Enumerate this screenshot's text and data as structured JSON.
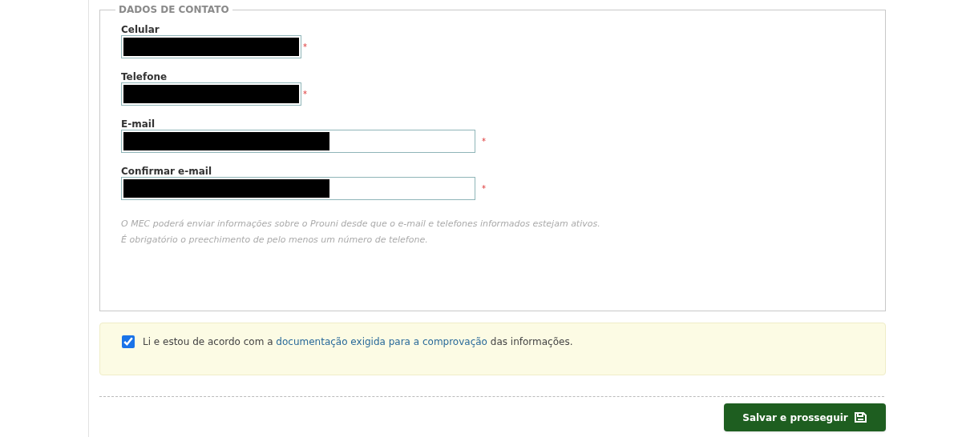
{
  "section": {
    "legend": "DADOS DE CONTATO",
    "fields": [
      {
        "label": "Celular",
        "kind": "phone",
        "required_mark": "*"
      },
      {
        "label": "Telefone",
        "kind": "phone",
        "required_mark": "*"
      },
      {
        "label": "E-mail",
        "kind": "email",
        "required_mark": "*"
      },
      {
        "label": "Confirmar e-mail",
        "kind": "email",
        "required_mark": "*"
      }
    ],
    "notes": [
      "O MEC poderá enviar informações sobre o Prouni desde que o e-mail e telefones informados estejam ativos.",
      "É obrigatório o preechimento de pelo menos um número de telefone."
    ]
  },
  "agreement": {
    "checked": true,
    "text_before": "Li e estou de acordo com a",
    "link": "documentação exigida para a comprovação",
    "text_after": "das informações."
  },
  "save_button": {
    "label": "Salvar e prosseguir"
  }
}
